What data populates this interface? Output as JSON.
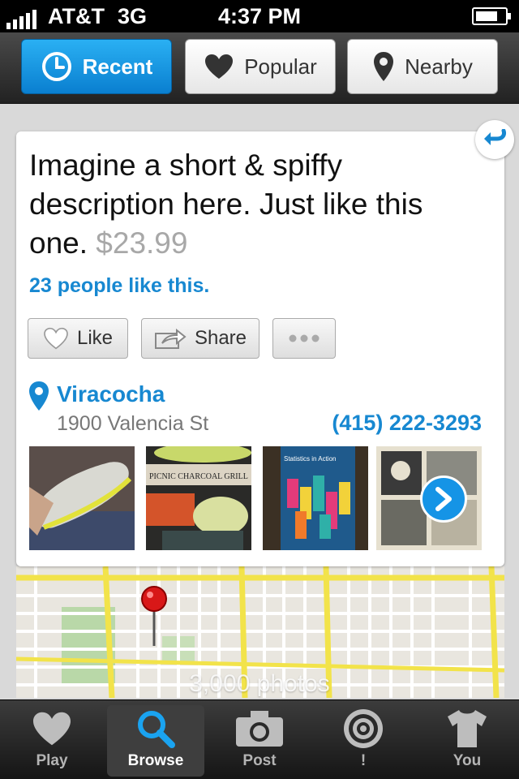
{
  "status": {
    "carrier": "AT&T",
    "network": "3G",
    "time": "4:37 PM",
    "battery_level": 0.75
  },
  "topnav": {
    "tabs": [
      {
        "label": "Recent",
        "icon": "clock-icon",
        "active": true
      },
      {
        "label": "Popular",
        "icon": "heart-icon",
        "active": false
      },
      {
        "label": "Nearby",
        "icon": "map-pin-icon",
        "active": false
      }
    ]
  },
  "item": {
    "description": "Imagine a short & spiffy description here. Just like this one.",
    "price": "$23.99",
    "likes_text": "23 people like this.",
    "like_label": "Like",
    "share_label": "Share"
  },
  "venue": {
    "name": "Viracocha",
    "address": "1900 Valencia St",
    "phone": "(415) 222-3293"
  },
  "thumbnails": [
    {
      "name": "sneaker-photo"
    },
    {
      "name": "charcoal-grill-photo",
      "text": "PICNIC CHARCOAL GRILL"
    },
    {
      "name": "statistics-book-photo",
      "text": "Statistics in Action"
    },
    {
      "name": "comic-book-photo"
    }
  ],
  "map": {
    "photos_label": "3,000 photos"
  },
  "tabbar": {
    "tabs": [
      {
        "label": "Play",
        "icon": "heart-icon",
        "active": false
      },
      {
        "label": "Browse",
        "icon": "search-icon",
        "active": true
      },
      {
        "label": "Post",
        "icon": "camera-icon",
        "active": false
      },
      {
        "label": "!",
        "icon": "target-icon",
        "active": false
      },
      {
        "label": "You",
        "icon": "tshirt-icon",
        "active": false
      }
    ]
  },
  "colors": {
    "accent": "#1788d1",
    "active_tab": "#0a8fe0"
  }
}
